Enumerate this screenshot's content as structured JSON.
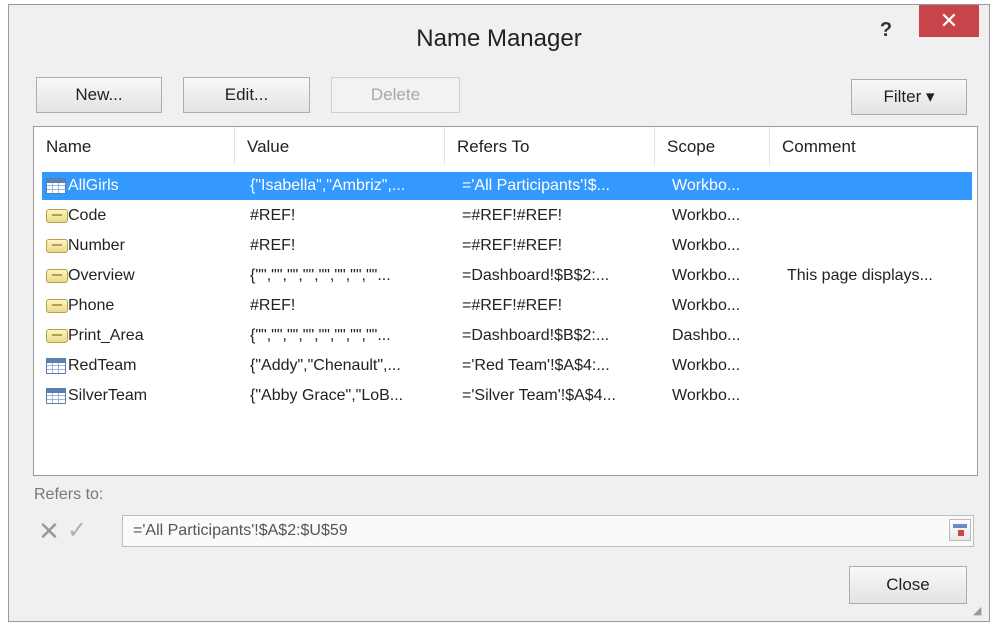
{
  "window": {
    "title": "Name Manager",
    "help_label": "?",
    "close_label": "✕"
  },
  "toolbar": {
    "new_label": "New...",
    "edit_label": "Edit...",
    "delete_label": "Delete",
    "filter_label": "Filter ▾"
  },
  "columns": [
    "Name",
    "Value",
    "Refers To",
    "Scope",
    "Comment"
  ],
  "rows": [
    {
      "name": "AllGirls",
      "icon": "table-icon",
      "value": "{\"Isabella\",\"Ambriz\",...",
      "refers_to": "='All Participants'!$...",
      "scope": "Workbo...",
      "comment": "",
      "selected": true
    },
    {
      "name": "Code",
      "icon": "name-tag-icon",
      "value": "#REF!",
      "refers_to": "=#REF!#REF!",
      "scope": "Workbo...",
      "comment": ""
    },
    {
      "name": "Number",
      "icon": "name-tag-icon",
      "value": "#REF!",
      "refers_to": "=#REF!#REF!",
      "scope": "Workbo...",
      "comment": ""
    },
    {
      "name": "Overview",
      "icon": "name-tag-icon",
      "value": "{\"\",\"\",\"\",\"\",\"\",\"\",\"\",\"\"...",
      "refers_to": "=Dashboard!$B$2:...",
      "scope": "Workbo...",
      "comment": "This page displays..."
    },
    {
      "name": "Phone",
      "icon": "name-tag-icon",
      "value": "#REF!",
      "refers_to": "=#REF!#REF!",
      "scope": "Workbo...",
      "comment": ""
    },
    {
      "name": "Print_Area",
      "icon": "name-tag-icon",
      "value": "{\"\",\"\",\"\",\"\",\"\",\"\",\"\",\"\"...",
      "refers_to": "=Dashboard!$B$2:...",
      "scope": "Dashbo...",
      "comment": ""
    },
    {
      "name": "RedTeam",
      "icon": "table-icon",
      "value": "{\"Addy\",\"Chenault\",...",
      "refers_to": "='Red Team'!$A$4:...",
      "scope": "Workbo...",
      "comment": ""
    },
    {
      "name": "SilverTeam",
      "icon": "table-icon",
      "value": "{\"Abby Grace\",\"LoB...",
      "refers_to": "='Silver Team'!$A$4...",
      "scope": "Workbo...",
      "comment": ""
    }
  ],
  "refers_to_section": {
    "label": "Refers to:",
    "cancel_glyph": "✕",
    "confirm_glyph": "✓",
    "formula": "='All Participants'!$A$2:$U$59"
  },
  "footer": {
    "close_label": "Close"
  },
  "colors": {
    "selection": "#3399ff",
    "close_button": "#c9444a"
  }
}
